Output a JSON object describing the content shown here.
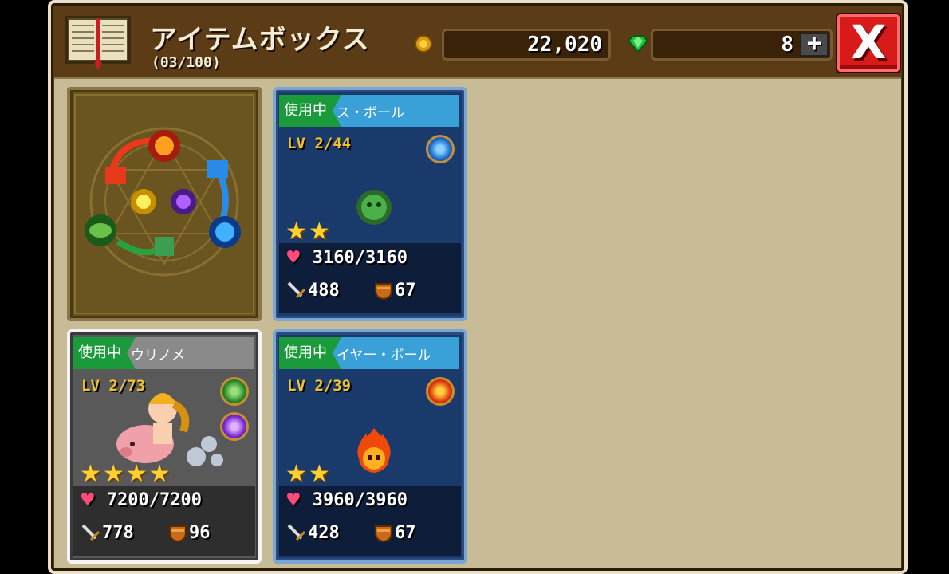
{
  "header": {
    "title": "アイテムボックス",
    "capacity": "(03/100)",
    "coins": "22,020",
    "gems": "8",
    "plus_label": "+",
    "close_label": "X"
  },
  "cards": [
    {
      "in_use": "使用中",
      "name": "ス・ボール",
      "level": "LV 2/44",
      "element": "water",
      "stars": "★★",
      "hp": "3160/3160",
      "attack": "488",
      "defense": "67"
    },
    {
      "in_use": "使用中",
      "name": "ウリノメ",
      "level": "LV 2/73",
      "element": "leaf",
      "element2": "dark",
      "stars": "★★★★",
      "hp": "7200/7200",
      "attack": "778",
      "defense": "96"
    },
    {
      "in_use": "使用中",
      "name": "イヤー・ボール",
      "level": "LV 2/39",
      "element": "fire",
      "stars": "★★",
      "hp": "3960/3960",
      "attack": "428",
      "defense": "67"
    }
  ],
  "icons": {
    "book": "book-icon",
    "coin": "coin-icon",
    "gem": "gem-icon",
    "heart": "heart-icon",
    "sword": "sword-icon",
    "shield": "shield-icon"
  },
  "heart_glyph": "♥",
  "colors": {
    "accent_red": "#d81a1a",
    "in_use_green": "#1a9a3a",
    "star_gold": "#ffd030",
    "card_blue": "#1a3a6c"
  }
}
